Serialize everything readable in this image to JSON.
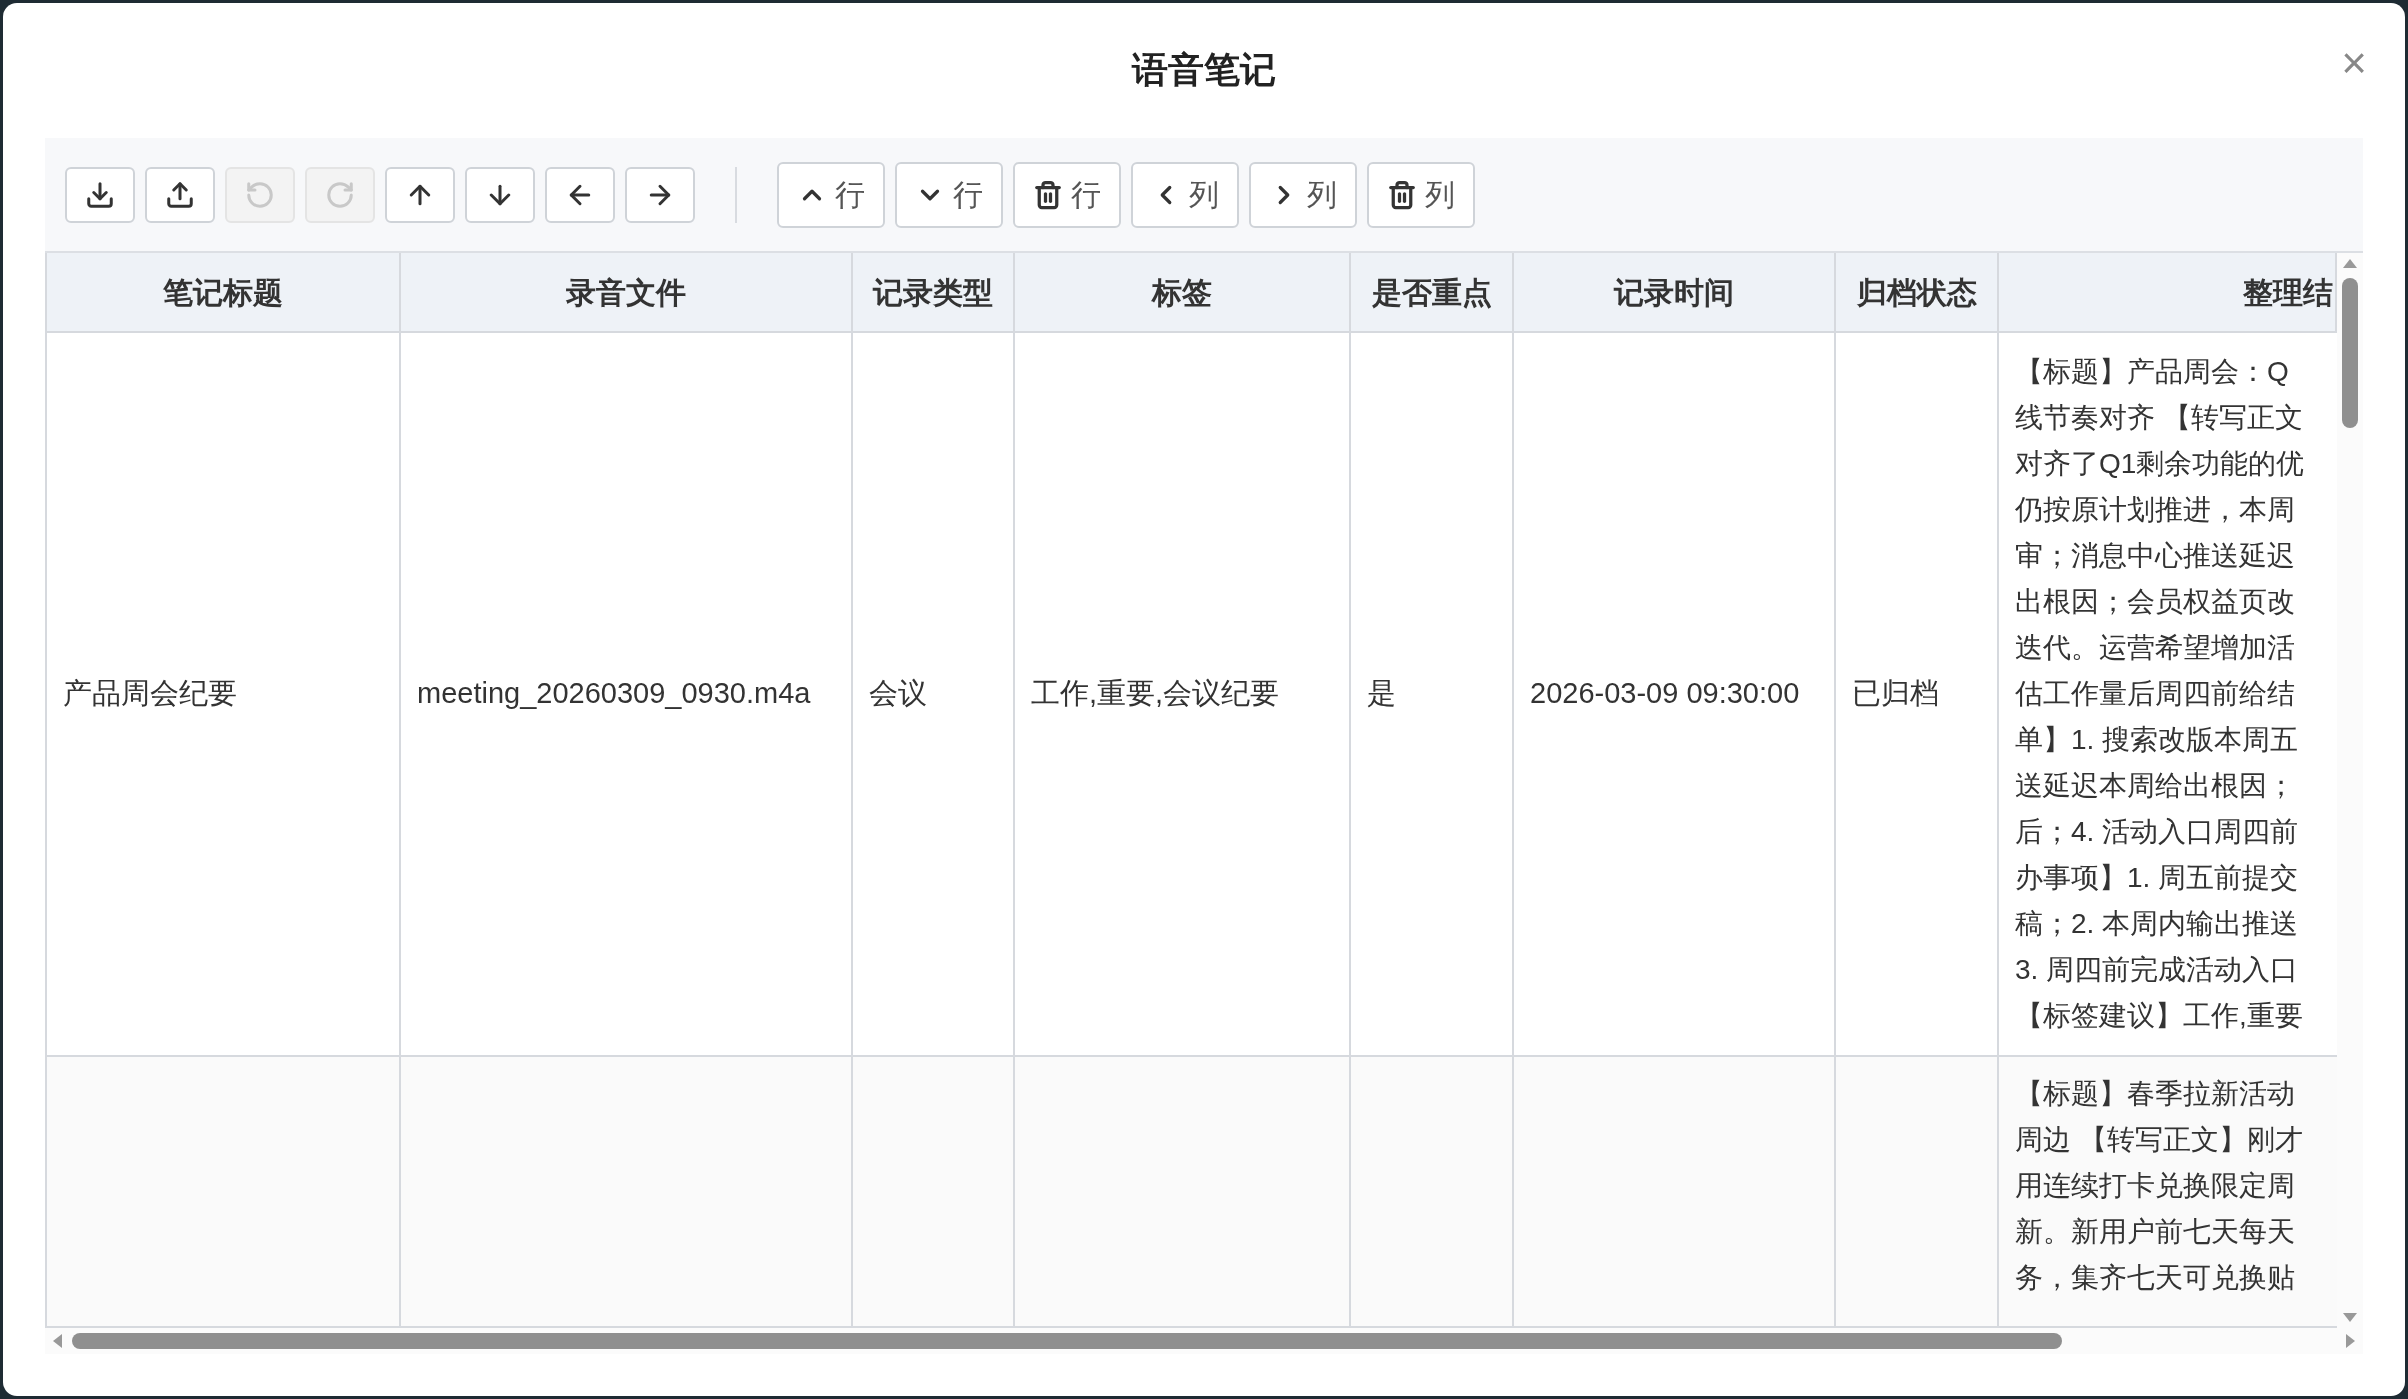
{
  "dialog": {
    "title": "语音笔记",
    "close": "×"
  },
  "toolbar": {
    "icon_buttons": [
      {
        "disabled": false
      },
      {
        "disabled": false
      },
      {
        "disabled": true
      },
      {
        "disabled": true
      },
      {
        "disabled": false
      },
      {
        "disabled": false
      },
      {
        "disabled": false
      },
      {
        "disabled": false
      }
    ],
    "text_buttons": [
      {
        "label": "行"
      },
      {
        "label": "行"
      },
      {
        "label": "行"
      },
      {
        "label": "列"
      },
      {
        "label": "列"
      },
      {
        "label": "列"
      }
    ]
  },
  "table": {
    "columns": [
      "笔记标题",
      "录音文件",
      "记录类型",
      "标签",
      "是否重点",
      "记录时间",
      "归档状态",
      "整理结"
    ],
    "rows": [
      {
        "cells": [
          "产品周会纪要",
          "meeting_20260309_0930.m4a",
          "会议",
          "工作,重要,会议纪要",
          "是",
          "2026-03-09 09:30:00",
          "已归档"
        ],
        "summary_lines": [
          "【标题】产品周会：Q",
          "线节奏对齐 【转写正文",
          "对齐了Q1剩余功能的优",
          "仍按原计划推进，本周",
          "审；消息中心推送延迟",
          "出根因；会员权益页改",
          "迭代。运营希望增加活",
          "估工作量后周四前给结",
          "单】1. 搜索改版本周五",
          "送延迟本周给出根因；",
          "后；4. 活动入口周四前",
          "办事项】1. 周五前提交",
          "稿；2. 本周内输出推送",
          "3. 周四前完成活动入口",
          "【标签建议】工作,重要"
        ]
      },
      {
        "cells": [
          "",
          "",
          "",
          "",
          "",
          "",
          ""
        ],
        "summary_lines": [
          "【标题】春季拉新活动",
          "周边 【转写正文】刚才",
          "用连续打卡兑换限定周",
          "新。新用户前七天每天",
          "务，集齐七天可兑换贴"
        ]
      }
    ]
  }
}
